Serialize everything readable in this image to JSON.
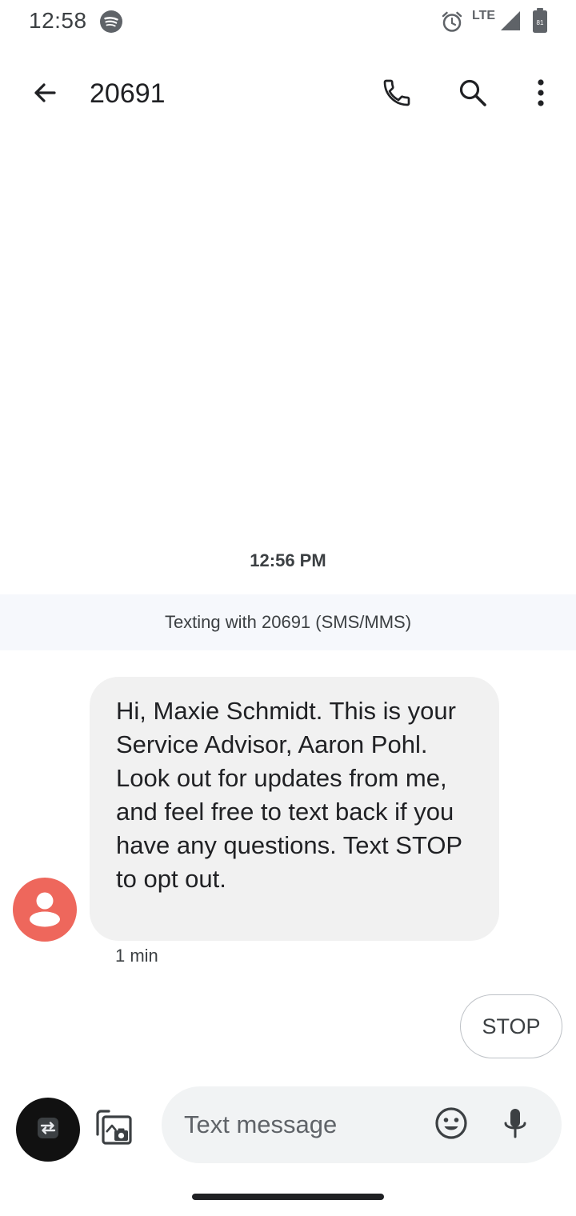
{
  "status_bar": {
    "time": "12:58",
    "network": "LTE",
    "battery_level": "81",
    "icons": [
      "spotify-icon",
      "alarm-icon",
      "signal-icon",
      "battery-icon"
    ]
  },
  "app_bar": {
    "title": "20691",
    "icons": [
      "back-arrow-icon",
      "phone-icon",
      "search-icon",
      "more-vert-icon"
    ]
  },
  "conversation": {
    "timestamp": "12:56 PM",
    "banner": "Texting with 20691 (SMS/MMS)",
    "messages": [
      {
        "text": "Hi, Maxie Schmidt. This is your Service Advisor, Aaron Pohl. Look out for updates from me, and feel free to text back if you have any questions. Text STOP to opt out.",
        "time": "1 min",
        "direction": "incoming"
      }
    ],
    "suggested_reply": "STOP"
  },
  "compose": {
    "placeholder": "Text message",
    "value": "",
    "icons": [
      "sim-switch-icon",
      "gallery-camera-icon",
      "emoji-icon",
      "mic-icon"
    ]
  },
  "colors": {
    "avatar": "#ee675c",
    "bubble": "#f1f1f1",
    "banner": "#f6f8fc",
    "compose_bg": "#f1f3f4",
    "text": "#202124"
  }
}
